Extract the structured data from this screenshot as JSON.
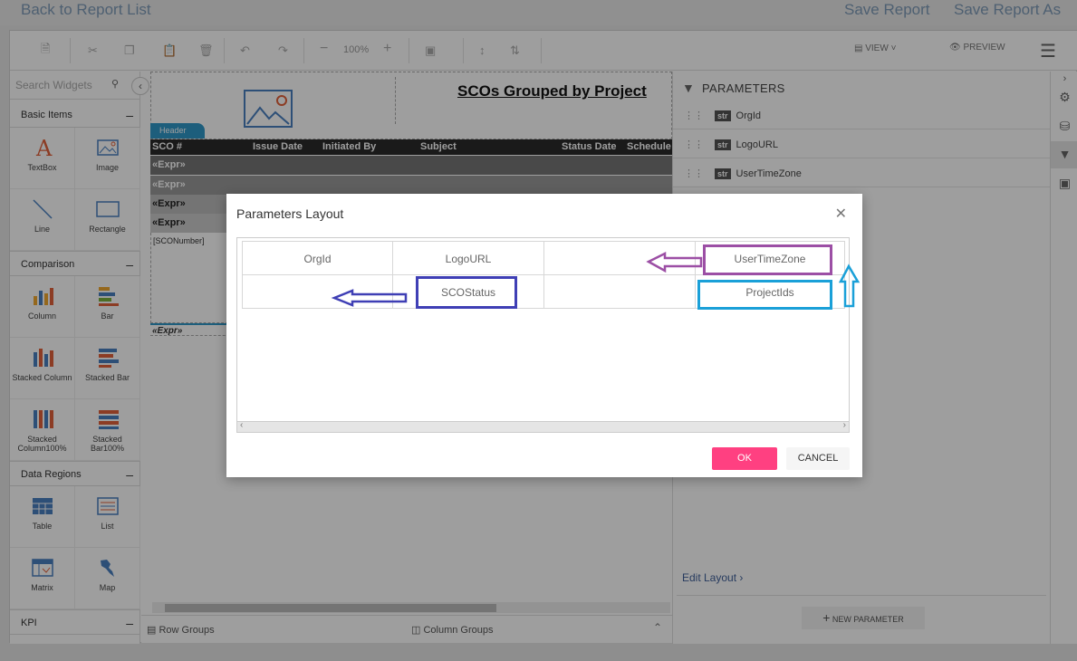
{
  "header": {
    "back_link": "Back to Report List",
    "save": "Save Report",
    "save_as": "Save Report As"
  },
  "toolbar": {
    "zoom": "100%",
    "view": "VIEW",
    "preview": "PREVIEW"
  },
  "widgets": {
    "search_placeholder": "Search Widgets",
    "categories": [
      "Basic Items",
      "Comparison",
      "Data Regions",
      "KPI"
    ],
    "items": [
      "TextBox",
      "Image",
      "Line",
      "Rectangle",
      "Column",
      "Bar",
      "Stacked Column",
      "Stacked Bar",
      "Stacked Column100%",
      "Stacked Bar100%",
      "Table",
      "List",
      "Matrix",
      "Map"
    ]
  },
  "report": {
    "title": "SCOs Grouped by Project",
    "header_tab": "Header",
    "columns": [
      "SCO #",
      "Issue Date",
      "Initiated By",
      "Subject",
      "Status Date",
      "Schedule In"
    ],
    "expr": "«Expr»",
    "sco_number": "[SCONumber]"
  },
  "bottom": {
    "row_groups": "Row Groups",
    "column_groups": "Column Groups"
  },
  "parameters_panel": {
    "title": "PARAMETERS",
    "type_badge": "str",
    "items": [
      "OrgId",
      "LogoURL",
      "UserTimeZone"
    ],
    "edit_layout": "Edit Layout",
    "new_param": "NEW PARAMETER"
  },
  "dialog": {
    "title": "Parameters Layout",
    "row1": [
      "OrgId",
      "LogoURL",
      "",
      "UserTimeZone"
    ],
    "row2": [
      "",
      "SCOStatus",
      "",
      "ProjectIds"
    ],
    "ok": "OK",
    "cancel": "CANCEL"
  },
  "colors": {
    "accent_pink": "#ff4081",
    "annot_purple": "#9c4fa5",
    "annot_blue": "#3f3fb5",
    "annot_cyan": "#1aa0d8"
  }
}
